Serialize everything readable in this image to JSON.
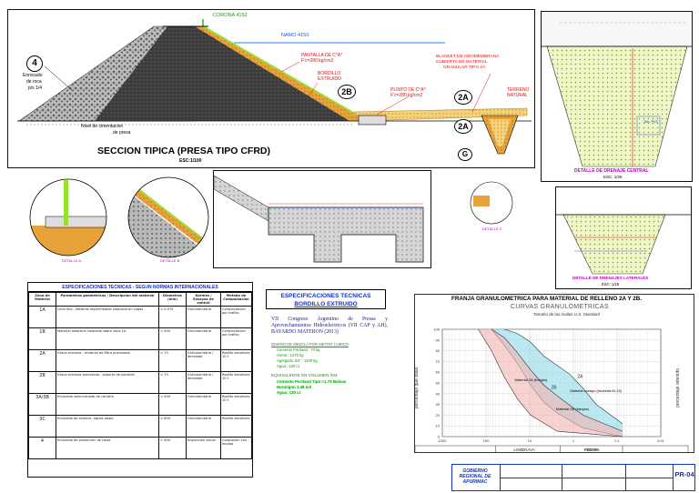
{
  "section": {
    "title": "SECCION TIPICA (PRESA TIPO CFRD)",
    "scale": "ESC:1/100",
    "corona": "CORONA 4152",
    "namo": "NAMO 4150",
    "zone4": "4",
    "zone4_text": [
      "Enrocado",
      "de roca",
      "p/s 1/4"
    ],
    "plinth_label": "PANTALLA DE C°A°",
    "plinth_fc": "F'c=280 kg/cm2",
    "bordillo_label": "BORDILLO",
    "bordillo_label2": "EXTRUIDO",
    "zone2b": "2B",
    "plinto_label": "PLINTO DE C°A°",
    "plinto_fc": "F'c=280 kg/cm2",
    "blanket_text": [
      "BLANKET DE GEOMEMBRANA",
      "CUBIERTA DE MATERIAL",
      "GRANULAR TIPO 2A"
    ],
    "zone2a_top": "2A",
    "zone2a_bottom": "2A",
    "terreno": [
      "TERRENO",
      "NATURAL"
    ],
    "zoneg": "G",
    "nivel_text": [
      "Nivel de cimentacion",
      "de presa"
    ]
  },
  "detail_central": {
    "title": "DETALLE DE DRENAJE CENTRAL",
    "scale": "ESC: 1/25"
  },
  "detail_lateral": {
    "title": "DETALLE DE DRENAJES LATERALES",
    "scale": "ESC: 1/25"
  },
  "detalle_a": "DETALLE A",
  "detalle_b": "DETALLE B",
  "detalle_c": "DETALLE C",
  "spec_table": {
    "title": "ESPECIFICACIONES TECNICAS - SEGUN NORMAS INTERNACIONALES",
    "headers": [
      "Zona de Material",
      "Parametros geometricos / Descripcion del material",
      "Diametros (mm)",
      "Normas / Ensayos de control",
      "Metodo de Compactacion"
    ],
    "rows": [
      {
        "zone": "1A",
        "desc": "Limo fino - Material impermeable colocado en capas",
        "diam": "< 0.075",
        "test": "Granulometria",
        "comp": "Compactacion por trafico"
      },
      {
        "zone": "1B",
        "desc": "Material aleatorio colocado sobre zona 1A",
        "diam": "< 400",
        "test": "Granulometria",
        "comp": "Compactacion por trafico"
      },
      {
        "zone": "2A",
        "desc": "Grava arenosa - material de filtro procesado",
        "diam": "< 75",
        "test": "Granulometria / densidad",
        "comp": "Rodillo vibratorio 10 t"
      },
      {
        "zone": "2B",
        "desc": "Grava arenosa procesada - soporte de pantalla",
        "diam": "< 75",
        "test": "Granulometria / densidad",
        "comp": "Rodillo vibratorio 10 t"
      },
      {
        "zone": "3A/3B",
        "desc": "Enrocado seleccionado de cantera",
        "diam": "< 400",
        "test": "Granulometria",
        "comp": "Rodillo vibratorio 10 t"
      },
      {
        "zone": "3C",
        "desc": "Enrocado de cantera, aguas abajo",
        "diam": "< 800",
        "test": "Granulometria",
        "comp": "Rodillo vibratorio"
      },
      {
        "zone": "4",
        "desc": "Enrocado de proteccion de talud",
        "diam": "> 400",
        "test": "Inspeccion visual",
        "comp": "Colocacion con equipo"
      }
    ]
  },
  "bordillo": {
    "heading1": "ESPECIFICACIONES TECNICAS",
    "heading2": "BORDILLO EXTRUIDO",
    "ref": "VII Congreso Argentino de Presas y Aprovechamientos Hidroelectricos (VII CAP y AH), BAYARDO MATERON (2013)",
    "mix_title": "DISEÑO DE MEZCLA POR METRO CUBICO",
    "mix": [
      "Cemento Portland : 70 kg",
      "Arena : 1270 kg",
      "Agregado 3/4\" : 1100 kg",
      "Agua : 120 Lt"
    ],
    "vol_title": "EQUIVALENTE EN VOLUMEN /M3",
    "vol": [
      "Cemento Portland Tipo I:1.76 Bolsas",
      "Hormigon 1.48 m3",
      "Agua: 120 Lt"
    ]
  },
  "chart_data": {
    "type": "area",
    "title": "FRANJA GRANULOMETRICA PARA MATERIAL DE RELLENO 2A Y 2B.",
    "subtitle": "CURVAS GRANULOMETRICAS",
    "top_axis": "Tamaño de las mallas U.S. Standard",
    "ylabel_left": "porcentaje que pasa",
    "ylabel_right": "porcentaje retenido",
    "xlog": true,
    "xlim": [
      0.01,
      1000
    ],
    "ylim": [
      0,
      100
    ],
    "x_ticks": [
      "0.01",
      "0.1",
      "1",
      "10",
      "100",
      "1000"
    ],
    "y_ticks": [
      0,
      10,
      20,
      30,
      40,
      50,
      60,
      70,
      80,
      90,
      100
    ],
    "soil_classes": [
      "LIMO",
      "ARENA",
      "GRAVA",
      "PIEDRA"
    ],
    "series": [
      {
        "name": "2A",
        "color": "#8fd8e8",
        "upper": {
          "x": [
            0.075,
            0.3,
            0.6,
            1.2,
            4.75,
            9.5,
            19,
            37.5
          ],
          "y": [
            12,
            30,
            45,
            58,
            75,
            88,
            96,
            100
          ]
        },
        "lower": {
          "x": [
            0.075,
            0.6,
            2.36,
            4.75,
            9.5,
            19,
            37.5,
            75
          ],
          "y": [
            0,
            8,
            22,
            32,
            48,
            68,
            85,
            100
          ]
        }
      },
      {
        "name": "2B",
        "color": "#f4b3b3",
        "upper": {
          "x": [
            0.075,
            0.6,
            2.36,
            4.75,
            9.5,
            19,
            37.5,
            75
          ],
          "y": [
            5,
            20,
            38,
            48,
            62,
            78,
            92,
            100
          ]
        },
        "lower": {
          "x": [
            0.075,
            2.36,
            9.5,
            19,
            37.5,
            75,
            150
          ],
          "y": [
            0,
            5,
            20,
            35,
            55,
            80,
            100
          ]
        }
      }
    ],
    "annotations": [
      "Material 2A (franjas)",
      "Material 2B (franjas)",
      "Material ensayo (muestra M-13)"
    ]
  },
  "titleblock": {
    "org": "GOBIERNO REGIONAL DE APURIMAC",
    "sheet": "PR-04"
  },
  "colors": {
    "rock": "#8a8a8a",
    "filter": "#e8a23a",
    "green": "#9ae030",
    "red": "#e01010"
  }
}
